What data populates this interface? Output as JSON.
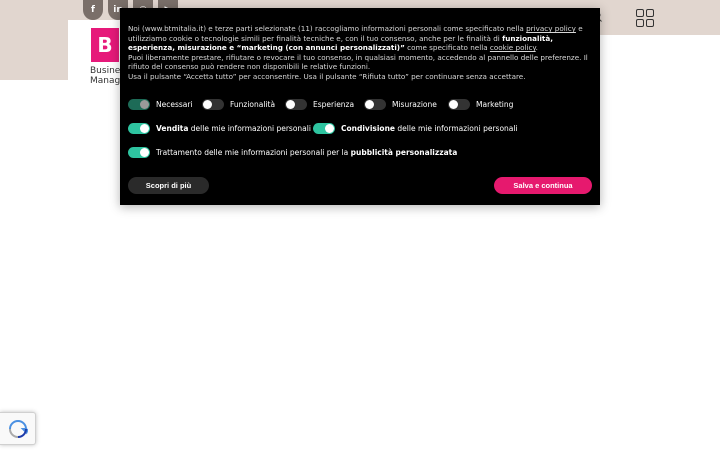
{
  "header": {
    "social_icons": [
      "facebook-icon",
      "linkedin-icon",
      "instagram-icon",
      "youtube-icon"
    ],
    "social_glyphs": [
      "f",
      "in",
      "◎",
      "▶"
    ],
    "logo_letter": "B",
    "logo_lines": [
      "Busines",
      "Manag"
    ]
  },
  "cookie_banner": {
    "text_1": "Noi (www.btmitalia.it) e terze parti selezionate (11) raccogliamo informazioni personali come specificato nella ",
    "privacy_link": "privacy policy",
    "text_2": " e utilizziamo cookie o tecnologie simili per finalità tecniche e, con il tuo consenso, anche per le finalità di ",
    "bold_1": "funzionalità, esperienza, misurazione e “marketing (con annunci personalizzati)”",
    "text_3": " come specificato nella ",
    "cookie_link": "cookie policy",
    "text_4": ".",
    "line_2": "Puoi liberamente prestare, rifiutare o revocare il tuo consenso, in qualsiasi momento, accedendo al pannello delle preferenze. Il rifiuto del consenso può rendere non disponibili le relative funzioni.",
    "line_3": "Usa il pulsante “Accetta tutto” per acconsentire. Usa il pulsante “Rifiuta tutto” per continuare senza accettare.",
    "categories": [
      {
        "label": "Necessari",
        "state": "locked"
      },
      {
        "label": "Funzionalità",
        "state": "off"
      },
      {
        "label": "Esperienza",
        "state": "off"
      },
      {
        "label": "Misurazione",
        "state": "off"
      },
      {
        "label": "Marketing",
        "state": "off"
      }
    ],
    "row2": [
      {
        "bold": "Vendita",
        "rest": " delle mie informazioni personali",
        "state": "on"
      },
      {
        "bold": "Condivisione",
        "rest": " delle mie informazioni personali",
        "state": "on"
      }
    ],
    "row3": {
      "pre": "Trattamento delle mie informazioni personali per la ",
      "bold": "pubblicità personalizzata",
      "state": "on"
    },
    "learn_more_label": "Scopri di più",
    "save_label": "Salva e continua"
  },
  "colors": {
    "accent": "#e6196e",
    "toggle_on": "#2ec4a0",
    "banner_bg": "#000000",
    "header_bg": "#e1d6cf"
  }
}
